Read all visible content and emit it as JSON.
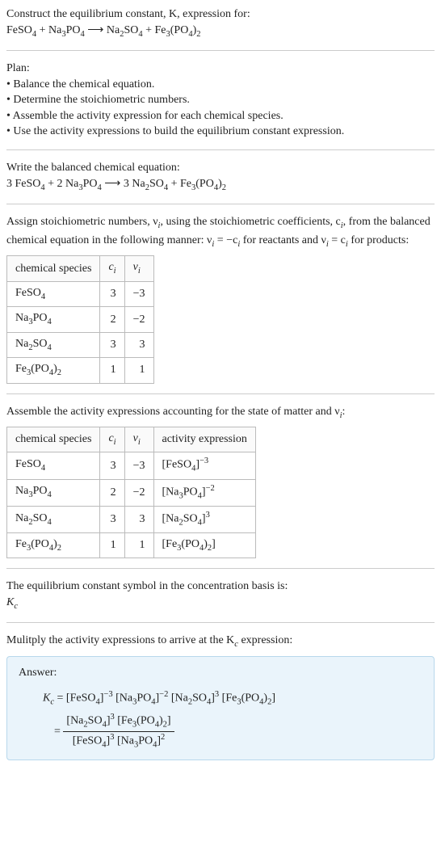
{
  "prompt": {
    "line1": "Construct the equilibrium constant, K, expression for:",
    "equation_lhs1": "FeSO",
    "equation_sub1": "4",
    "plus1": " + Na",
    "equation_sub2": "3",
    "po4": "PO",
    "equation_sub3": "4",
    "arrow": " ⟶ ",
    "rhs1": "Na",
    "rhs_sub1": "2",
    "rhs2": "SO",
    "rhs_sub2": "4",
    "plus2": " + Fe",
    "rhs_sub3": "3",
    "rhs3": "(PO",
    "rhs_sub4": "4",
    "rhs4": ")",
    "rhs_sub5": "2"
  },
  "plan": {
    "title": "Plan:",
    "b1": "• Balance the chemical equation.",
    "b2": "• Determine the stoichiometric numbers.",
    "b3": "• Assemble the activity expression for each chemical species.",
    "b4": "• Use the activity expressions to build the equilibrium constant expression."
  },
  "balanced": {
    "title": "Write the balanced chemical equation:",
    "c1": "3 FeSO",
    "s1": "4",
    "p1": " + 2 Na",
    "s2": "3",
    "p2": "PO",
    "s3": "4",
    "arrow": " ⟶ ",
    "c2": "3 Na",
    "s4": "2",
    "p3": "SO",
    "s5": "4",
    "p4": " + Fe",
    "s6": "3",
    "p5": "(PO",
    "s7": "4",
    "p6": ")",
    "s8": "2"
  },
  "assign": {
    "text1": "Assign stoichiometric numbers, ν",
    "sub_i1": "i",
    "text2": ", using the stoichiometric coefficients, c",
    "sub_i2": "i",
    "text3": ", from the balanced chemical equation in the following manner: ν",
    "sub_i3": "i",
    "text4": " = −c",
    "sub_i4": "i",
    "text5": " for reactants and ν",
    "sub_i5": "i",
    "text6": " = c",
    "sub_i6": "i",
    "text7": " for products:"
  },
  "table1": {
    "h1": "chemical species",
    "h2": "c",
    "h2sub": "i",
    "h3": "ν",
    "h3sub": "i",
    "rows": [
      {
        "sp_a": "FeSO",
        "sp_sub": "4",
        "c": "3",
        "v": "−3"
      },
      {
        "sp_a": "Na",
        "sp_sub1": "3",
        "sp_b": "PO",
        "sp_sub2": "4",
        "c": "2",
        "v": "−2"
      },
      {
        "sp_a": "Na",
        "sp_sub1": "2",
        "sp_b": "SO",
        "sp_sub2": "4",
        "c": "3",
        "v": "3"
      },
      {
        "sp_a": "Fe",
        "sp_sub1": "3",
        "sp_b": "(PO",
        "sp_sub2": "4",
        "sp_c": ")",
        "sp_sub3": "2",
        "c": "1",
        "v": "1"
      }
    ]
  },
  "assemble": {
    "text1": "Assemble the activity expressions accounting for the state of matter and ν",
    "sub_i": "i",
    "text2": ":"
  },
  "table2": {
    "h1": "chemical species",
    "h2": "c",
    "h2sub": "i",
    "h3": "ν",
    "h3sub": "i",
    "h4": "activity expression",
    "rows": [
      {
        "sp_a": "FeSO",
        "sp_sub": "4",
        "c": "3",
        "v": "−3",
        "ae_a": "[FeSO",
        "ae_sub": "4",
        "ae_b": "]",
        "ae_sup": "−3"
      },
      {
        "sp_a": "Na",
        "sp_sub1": "3",
        "sp_b": "PO",
        "sp_sub2": "4",
        "c": "2",
        "v": "−2",
        "ae_a": "[Na",
        "ae_sub1": "3",
        "ae_b": "PO",
        "ae_sub2": "4",
        "ae_c": "]",
        "ae_sup": "−2"
      },
      {
        "sp_a": "Na",
        "sp_sub1": "2",
        "sp_b": "SO",
        "sp_sub2": "4",
        "c": "3",
        "v": "3",
        "ae_a": "[Na",
        "ae_sub1": "2",
        "ae_b": "SO",
        "ae_sub2": "4",
        "ae_c": "]",
        "ae_sup": "3"
      },
      {
        "sp_a": "Fe",
        "sp_sub1": "3",
        "sp_b": "(PO",
        "sp_sub2": "4",
        "sp_c": ")",
        "sp_sub3": "2",
        "c": "1",
        "v": "1",
        "ae_a": "[Fe",
        "ae_sub1": "3",
        "ae_b": "(PO",
        "ae_sub2": "4",
        "ae_c": ")",
        "ae_sub3": "2",
        "ae_d": "]"
      }
    ]
  },
  "eqsym": {
    "line1": "The equilibrium constant symbol in the concentration basis is:",
    "line2a": "K",
    "line2sub": "c"
  },
  "multiply": {
    "text1": "Mulitply the activity expressions to arrive at the K",
    "sub": "c",
    "text2": " expression:"
  },
  "answer": {
    "label": "Answer:",
    "kc_a": "K",
    "kc_sub": "c",
    "eq": " = ",
    "t1": "[FeSO",
    "t1s": "4",
    "t1b": "]",
    "t1sup": "−3",
    "t2": " [Na",
    "t2s1": "3",
    "t2b": "PO",
    "t2s2": "4",
    "t2c": "]",
    "t2sup": "−2",
    "t3": " [Na",
    "t3s1": "2",
    "t3b": "SO",
    "t3s2": "4",
    "t3c": "]",
    "t3sup": "3",
    "t4": " [Fe",
    "t4s1": "3",
    "t4b": "(PO",
    "t4s2": "4",
    "t4c": ")",
    "t4s3": "2",
    "t4d": "]",
    "eq2": " = ",
    "num_a": "[Na",
    "num_s1": "2",
    "num_b": "SO",
    "num_s2": "4",
    "num_c": "]",
    "num_sup1": "3",
    "num_d": " [Fe",
    "num_s3": "3",
    "num_e": "(PO",
    "num_s4": "4",
    "num_f": ")",
    "num_s5": "2",
    "num_g": "]",
    "den_a": "[FeSO",
    "den_s1": "4",
    "den_b": "]",
    "den_sup1": "3",
    "den_c": " [Na",
    "den_s2": "3",
    "den_d": "PO",
    "den_s3": "4",
    "den_e": "]",
    "den_sup2": "2"
  }
}
